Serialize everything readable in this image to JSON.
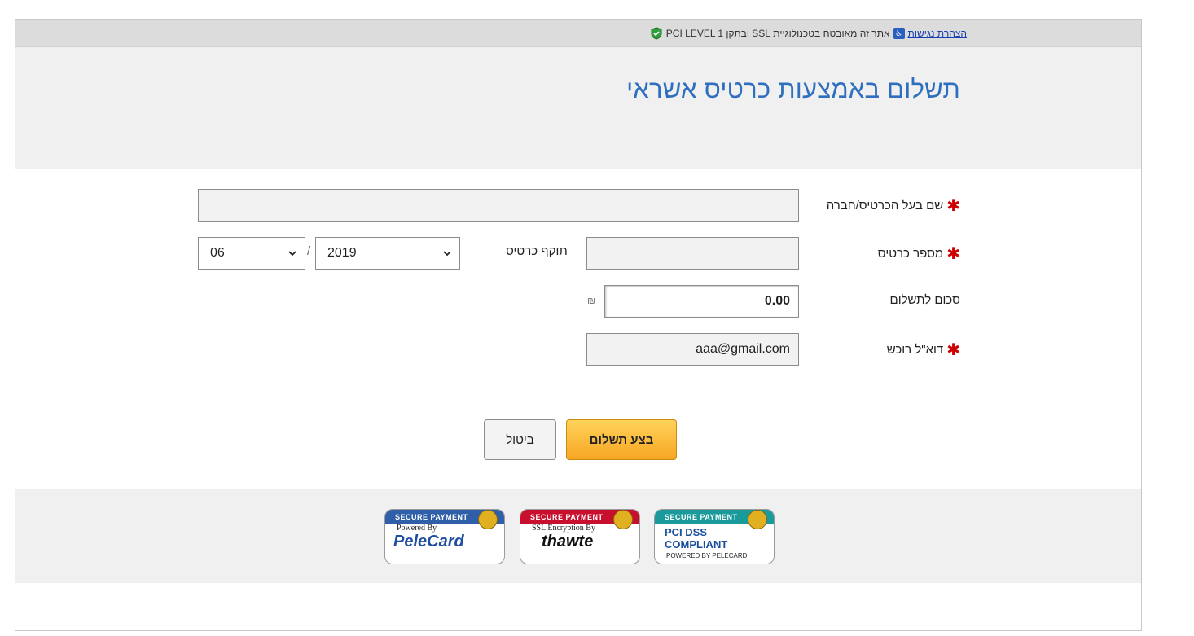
{
  "topbar": {
    "security_text": "אתר זה מאובטח בטכנולוגיית SSL ובתקן PCI LEVEL 1",
    "accessibility_link": "הצהרת נגישות",
    "accessibility_icon": "accessibility-icon",
    "shield_icon": "shield-icon"
  },
  "header": {
    "title": "תשלום באמצעות כרטיס אשראי"
  },
  "form": {
    "cardholder_label": "שם בעל הכרטיס/חברה",
    "cardholder_value": "",
    "card_number_label": "מספר כרטיס",
    "card_number_value": "",
    "expiry_label": "תוקף כרטיס",
    "expiry_year": "2019",
    "expiry_month": "06",
    "expiry_separator": "/",
    "amount_label": "סכום לתשלום",
    "amount_value": "0.00",
    "currency_symbol": "₪",
    "email_label": "דוא\"ל רוכש",
    "email_value": "aaa@gmail.com",
    "required_marker": "✱"
  },
  "buttons": {
    "pay": "בצע תשלום",
    "cancel": "ביטול"
  },
  "badges": [
    {
      "band": "SECURE PAYMENT",
      "sub": "Powered By",
      "brand": "PeleCard",
      "color": "#2f5fa8"
    },
    {
      "band": "SECURE PAYMENT",
      "sub": "SSL Encryption By",
      "brand": "thawte",
      "color": "#c8102e"
    },
    {
      "band": "SECURE PAYMENT",
      "sub": "POWERED BY PELECARD",
      "brand": "PCI DSS COMPLIANT",
      "color": "#1a9a9a"
    }
  ],
  "colors": {
    "title": "#2f6fbf",
    "required": "#cc0000",
    "pay_button": "#f8a623"
  }
}
